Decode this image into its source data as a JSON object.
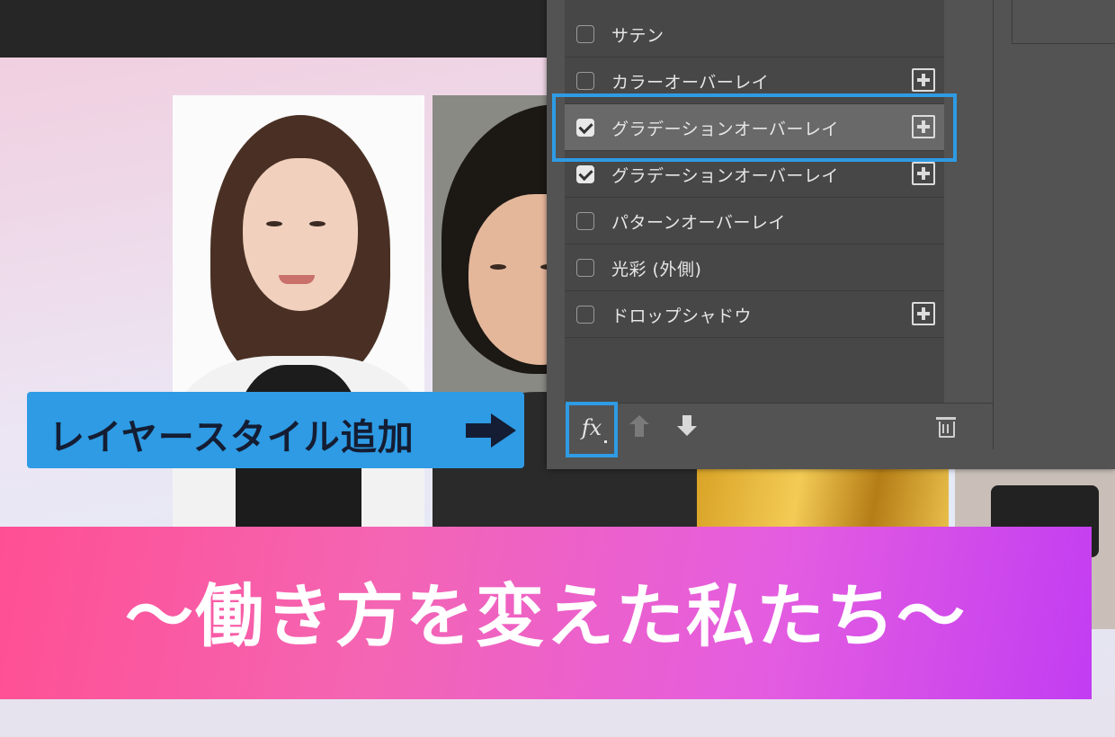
{
  "layer_style_panel": {
    "items": [
      {
        "label": "サテン",
        "checked": false,
        "has_plus": false,
        "selected": false
      },
      {
        "label": "カラーオーバーレイ",
        "checked": false,
        "has_plus": true,
        "selected": false
      },
      {
        "label": "グラデーションオーバーレイ",
        "checked": true,
        "has_plus": true,
        "selected": true
      },
      {
        "label": "グラデーションオーバーレイ",
        "checked": true,
        "has_plus": true,
        "selected": false
      },
      {
        "label": "パターンオーバーレイ",
        "checked": false,
        "has_plus": false,
        "selected": false
      },
      {
        "label": "光彩 (外側)",
        "checked": false,
        "has_plus": false,
        "selected": false
      },
      {
        "label": "ドロップシャドウ",
        "checked": false,
        "has_plus": true,
        "selected": false
      }
    ],
    "footer": {
      "fx_label": "fx",
      "move_up_icon": "arrow-up-icon",
      "move_down_icon": "arrow-down-icon",
      "delete_icon": "trash-icon"
    }
  },
  "callout": {
    "text": "レイヤースタイル追加",
    "arrow_icon": "arrow-right-icon",
    "color": "#2e9be4"
  },
  "banner": {
    "title": "〜働き方を変えた私たち〜",
    "gradient_start": "#ff4f93",
    "gradient_end": "#c23df2"
  },
  "highlight_color": "#2e9be4"
}
